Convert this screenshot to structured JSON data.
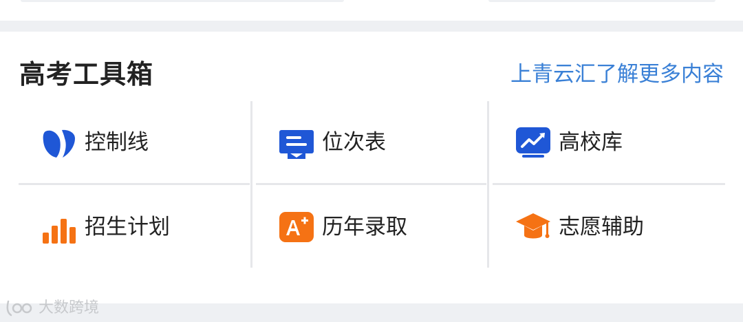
{
  "toolbox": {
    "title": "高考工具箱",
    "more_link": "上青云汇了解更多内容",
    "colors": {
      "blue": "#1f57d6",
      "orange": "#f57214",
      "link": "#3a80d6"
    },
    "items": [
      {
        "label": "控制线",
        "icon": "control-line-icon"
      },
      {
        "label": "位次表",
        "icon": "rank-table-icon"
      },
      {
        "label": "高校库",
        "icon": "university-database-icon"
      },
      {
        "label": "招生计划",
        "icon": "enrollment-plan-icon"
      },
      {
        "label": "历年录取",
        "icon": "admission-history-icon"
      },
      {
        "label": "志愿辅助",
        "icon": "application-assist-icon"
      }
    ]
  },
  "watermark": {
    "text": "大数跨境"
  }
}
